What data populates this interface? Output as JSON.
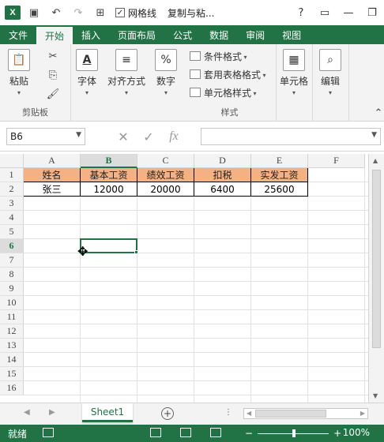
{
  "qat": {
    "app_icon": "X",
    "checkbox_mark": "✓",
    "gridlines_label": "网格线",
    "copy_paste_label": "复制与粘...",
    "help": "?",
    "minimize": "—",
    "close": "✕"
  },
  "tabs": [
    "文件",
    "开始",
    "插入",
    "页面布局",
    "公式",
    "数据",
    "审阅",
    "视图"
  ],
  "ribbon": {
    "paste": "粘贴",
    "clipboard_group": "剪贴板",
    "font": "字体",
    "alignment": "对齐方式",
    "number": "数字",
    "conditional": "条件格式",
    "table_format": "套用表格格式",
    "cell_style": "单元格样式",
    "style_group": "样式",
    "cells": "单元格",
    "editing": "编辑"
  },
  "formula_bar": {
    "name_box": "B6",
    "fx": "fx",
    "cancel": "✕",
    "confirm": "✓",
    "value": ""
  },
  "columns": [
    "A",
    "B",
    "C",
    "D",
    "E",
    "F"
  ],
  "rows": [
    "1",
    "2",
    "3",
    "4",
    "5",
    "6",
    "7",
    "8",
    "9",
    "10",
    "11",
    "12",
    "13",
    "14",
    "15",
    "16"
  ],
  "table": {
    "headers": [
      "姓名",
      "基本工资",
      "绩效工资",
      "扣税",
      "实发工资"
    ],
    "row2": [
      "张三",
      "12000",
      "20000",
      "6400",
      "25600"
    ]
  },
  "selected_cell": "B6",
  "sheet": {
    "tab": "Sheet1",
    "add": "+"
  },
  "status": {
    "ready": "就绪",
    "zoom": "100%",
    "zoom_minus": "−",
    "zoom_plus": "+"
  },
  "colors": {
    "accent": "#217346",
    "header_fill": "#f4b183"
  }
}
